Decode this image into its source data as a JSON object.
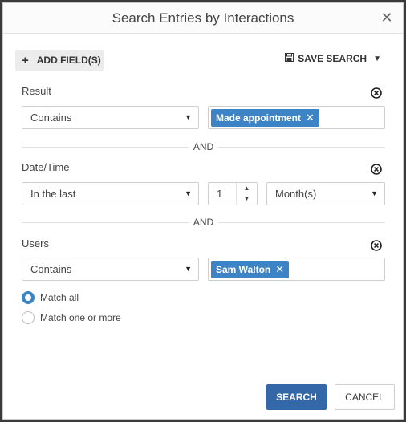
{
  "dialog": {
    "title": "Search Entries by Interactions",
    "close_icon": "close-icon"
  },
  "toolbar": {
    "add_field_label": "ADD FIELD(S)",
    "save_search_label": "SAVE SEARCH"
  },
  "criteria": [
    {
      "label": "Result",
      "operator": "Contains",
      "tags": [
        "Made appointment"
      ]
    },
    {
      "label": "Date/Time",
      "operator": "In the last",
      "number": "1",
      "unit": "Month(s)"
    },
    {
      "label": "Users",
      "operator": "Contains",
      "tags": [
        "Sam Walton"
      ]
    }
  ],
  "separator_text": "AND",
  "match_options": {
    "selected": "Match all",
    "options": [
      "Match all",
      "Match one or more"
    ]
  },
  "footer": {
    "search_label": "SEARCH",
    "cancel_label": "CANCEL"
  },
  "colors": {
    "accent": "#3467a7",
    "tag": "#3d84c6"
  }
}
